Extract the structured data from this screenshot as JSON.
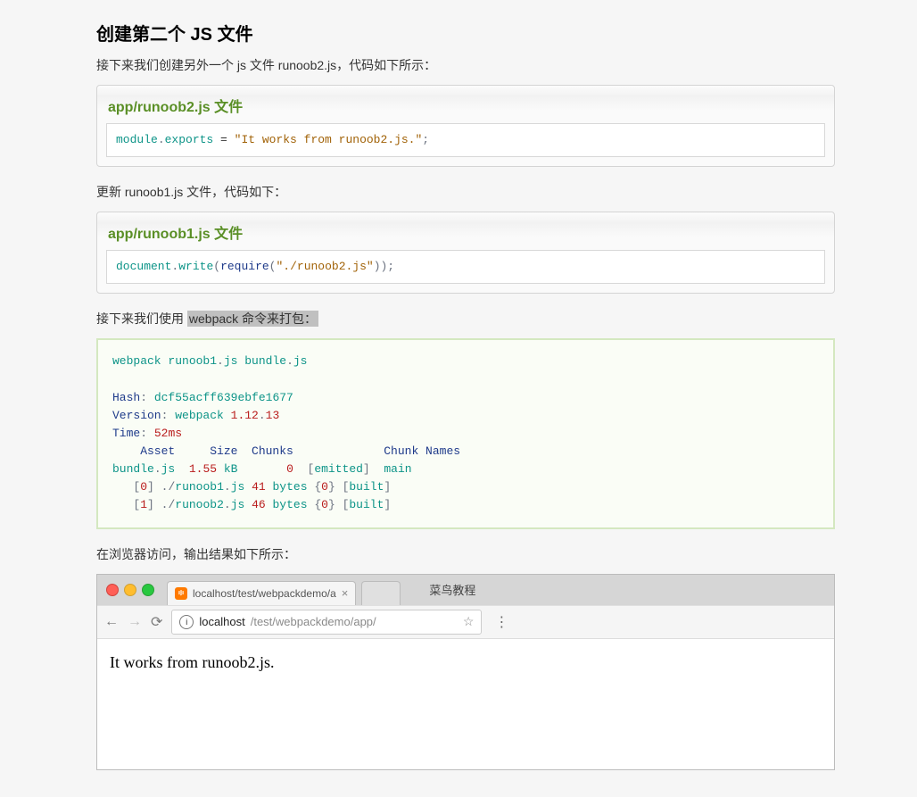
{
  "heading": "创建第二个 JS 文件",
  "p1": "接下来我们创建另外一个 js 文件 runoob2.js，代码如下所示：",
  "box1": {
    "title": "app/runoob2.js 文件",
    "code": {
      "t1": "module",
      "t2": ".",
      "t3": "exports",
      "t4": " = ",
      "t5": "\"It works from runoob2.js.\"",
      "t6": ";"
    }
  },
  "p2": "更新 runoob1.js 文件，代码如下：",
  "box2": {
    "title": "app/runoob1.js 文件",
    "code": {
      "t1": "document",
      "t2": ".",
      "t3": "write",
      "t4": "(",
      "t5": "require",
      "t6": "(",
      "t7": "\"./runoob2.js\"",
      "t8": "));"
    }
  },
  "p3": {
    "pre": "接下来我们使用 ",
    "sel": "webpack 命令来打包：",
    "post": ""
  },
  "term": {
    "l1a": "webpack runoob1",
    "l1b": ".",
    "l1c": "js bundle",
    "l1d": ".",
    "l1e": "js",
    "l3a": "Hash",
    "l3b": ":",
    "l3c": " dcf55acff639ebfe1677",
    "l4a": "Version",
    "l4b": ":",
    "l4c": " webpack ",
    "l4d": "1.12",
    "l4e": ".",
    "l4f": "13",
    "l5a": "Time",
    "l5b": ":",
    "l5c": " ",
    "l5d": "52ms",
    "l6": "    Asset     Size  Chunks             Chunk Names",
    "l7a": "bundle",
    "l7b": ".",
    "l7c": "js  ",
    "l7d": "1.55",
    "l7e": " kB       ",
    "l7f": "0",
    "l7g": "  ",
    "l7h": "[",
    "l7i": "emitted",
    "l7j": "]",
    "l7k": "  main",
    "l8a": "   ",
    "l8b": "[",
    "l8c": "0",
    "l8d": "]",
    "l8e": " ",
    "l8f": "./",
    "l8g": "runoob1",
    "l8h": ".",
    "l8i": "js ",
    "l8j": "41",
    "l8k": " bytes ",
    "l8l": "{",
    "l8m": "0",
    "l8n": "}",
    "l8o": " ",
    "l8p": "[",
    "l8q": "built",
    "l8r": "]",
    "l9a": "   ",
    "l9b": "[",
    "l9c": "1",
    "l9d": "]",
    "l9e": " ",
    "l9f": "./",
    "l9g": "runoob2",
    "l9h": ".",
    "l9i": "js ",
    "l9j": "46",
    "l9k": " bytes ",
    "l9l": "{",
    "l9m": "0",
    "l9n": "}",
    "l9o": " ",
    "l9p": "[",
    "l9q": "built",
    "l9r": "]"
  },
  "p4": "在浏览器访问，输出结果如下所示：",
  "browser": {
    "tab1": "localhost/test/webpackdemo/a",
    "tab2": "菜鸟教程",
    "urlHost": "localhost",
    "urlPath": "/test/webpackdemo/app/",
    "page": "It works from runoob2.js."
  }
}
